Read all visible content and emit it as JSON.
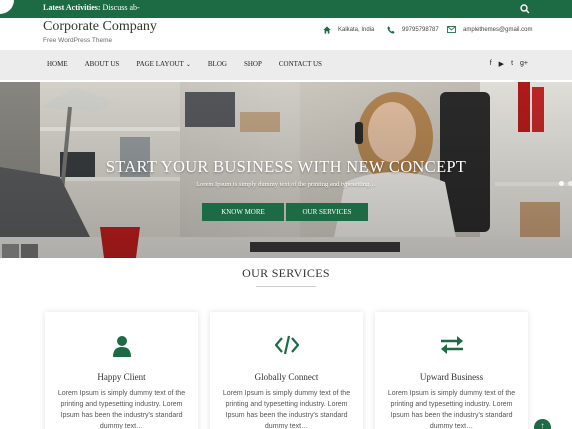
{
  "topbar": {
    "activities_label": "Latest Activities:",
    "activities_text": "Discuss ab-"
  },
  "header": {
    "site_title": "Corporate Company",
    "tagline": "Free WordPress Theme",
    "location": "Kalkata, India",
    "phone": "99795798787",
    "email": "amplethemes@gmail.com"
  },
  "nav": {
    "items": [
      {
        "label": "HOME"
      },
      {
        "label": "ABOUT US"
      },
      {
        "label": "PAGE LAYOUT",
        "has_caret": true
      },
      {
        "label": "BLOG"
      },
      {
        "label": "SHOP"
      },
      {
        "label": "CONTACT US"
      }
    ],
    "social": [
      "facebook",
      "youtube",
      "twitter",
      "google-plus"
    ],
    "social_glyphs": {
      "facebook": "f",
      "youtube": "▶",
      "twitter": "t",
      "google-plus": "g+"
    }
  },
  "hero": {
    "title": "START YOUR BUSINESS WITH NEW CONCEPT",
    "subtitle": "Lorem Ipsum is simply dummy text of the printing and typesetting…",
    "btn_know": "KNOW MORE",
    "btn_services": "OUR SERVICES"
  },
  "services": {
    "heading": "OUR SERVICES",
    "cards": [
      {
        "icon": "user-icon",
        "title": "Happy Client",
        "text": "Lorem Ipsum is simply dummy text of the printing and typesetting industry. Lorem Ipsum has been the industry's standard dummy text…"
      },
      {
        "icon": "code-icon",
        "title": "Globally Connect",
        "text": "Lorem Ipsum is simply dummy text of the printing and typesetting industry. Lorem Ipsum has been the industry's standard dummy text…"
      },
      {
        "icon": "exchange-icon",
        "title": "Upward Business",
        "text": "Lorem Ipsum is simply dummy text of the printing and typesetting industry. Lorem Ipsum has been the industry's standard dummy text…"
      }
    ]
  },
  "colors": {
    "brand_green": "#1c6b44",
    "nav_bg": "#ececec"
  }
}
